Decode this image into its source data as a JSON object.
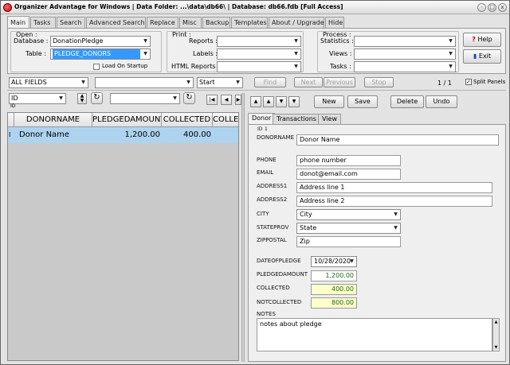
{
  "window": {
    "title": "Organizer Advantage for Windows | Data Folder: ...\\data\\db66\\ | Database: db66.fdb [Full Access]",
    "controls": {
      "minimize": "-",
      "maximize": "□",
      "close": "x"
    }
  },
  "main_tabs": [
    "Main",
    "Tasks",
    "Search",
    "Advanced Search",
    "Replace",
    "Misc",
    "Backup",
    "Templates",
    "About / Upgrade",
    "Hide"
  ],
  "open_group": {
    "title": "Open :",
    "database_label": "Database :",
    "database_value": "DonationPledge",
    "table_label": "Table :",
    "table_value": "PLEDGE_DONORS",
    "load_on_startup": "Load On Startup"
  },
  "print_group": {
    "title": "Print :",
    "reports_label": "Reports :",
    "labels_label": "Labels :",
    "html_reports_label": "HTML Reports :"
  },
  "process_group": {
    "title": "Process :",
    "statistics_label": "Statistics :",
    "views_label": "Views :",
    "tasks_label": "Tasks :"
  },
  "side_buttons": {
    "help": "Help",
    "exit": "Exit"
  },
  "search_bar": {
    "fields_value": "ALL FIELDS",
    "match_value": "Start",
    "find": "Find",
    "next": "Next",
    "previous": "Previous",
    "stop": "Stop",
    "record_count": "1 / 1",
    "split_panels": "Split Panels"
  },
  "sort_bar": {
    "sort_field": "ID",
    "sort_sub": "ID"
  },
  "record_buttons": {
    "new": "New",
    "save": "Save",
    "delete": "Delete",
    "undo": "Undo"
  },
  "grid": {
    "columns": [
      "DONORNAME",
      "PLEDGEDAMOUNT",
      "COLLECTED",
      "COLLECT"
    ],
    "row_marker": "I",
    "rows": [
      [
        "Donor Name",
        "1,200.00",
        "400.00",
        ""
      ]
    ]
  },
  "form_tabs": [
    "Donor",
    "Transactions",
    "View"
  ],
  "form": {
    "id_label": "ID",
    "id_value": "1",
    "donorname_label": "DONORNAME",
    "donorname_value": "Donor Name",
    "phone_label": "PHONE",
    "phone_value": "phone number",
    "email_label": "EMAIL",
    "email_value": "donot@email.com",
    "address1_label": "ADDRESS1",
    "address1_value": "Address line 1",
    "address2_label": "ADDRESS2",
    "address2_value": "Address line 2",
    "city_label": "CITY",
    "city_value": "City",
    "state_label": "STATEPROV",
    "state_value": "State",
    "zip_label": "ZIPPOSTAL",
    "zip_value": "Zip",
    "date_label": "DATEOFPLEDGE",
    "date_value": "10/28/2020",
    "pledged_label": "PLEDGEDAMOUNT",
    "pledged_value": "1,200.00",
    "collected_label": "COLLECTED",
    "collected_value": "400.00",
    "notcollected_label": "NOTCOLLECTED",
    "notcollected_value": "800.00",
    "notes_label": "NOTES",
    "notes_value": "notes about pledge"
  },
  "colors": {
    "selection": "#3399ff",
    "grid_row": "#aed3ef",
    "yellow_field": "#ffffcc"
  }
}
